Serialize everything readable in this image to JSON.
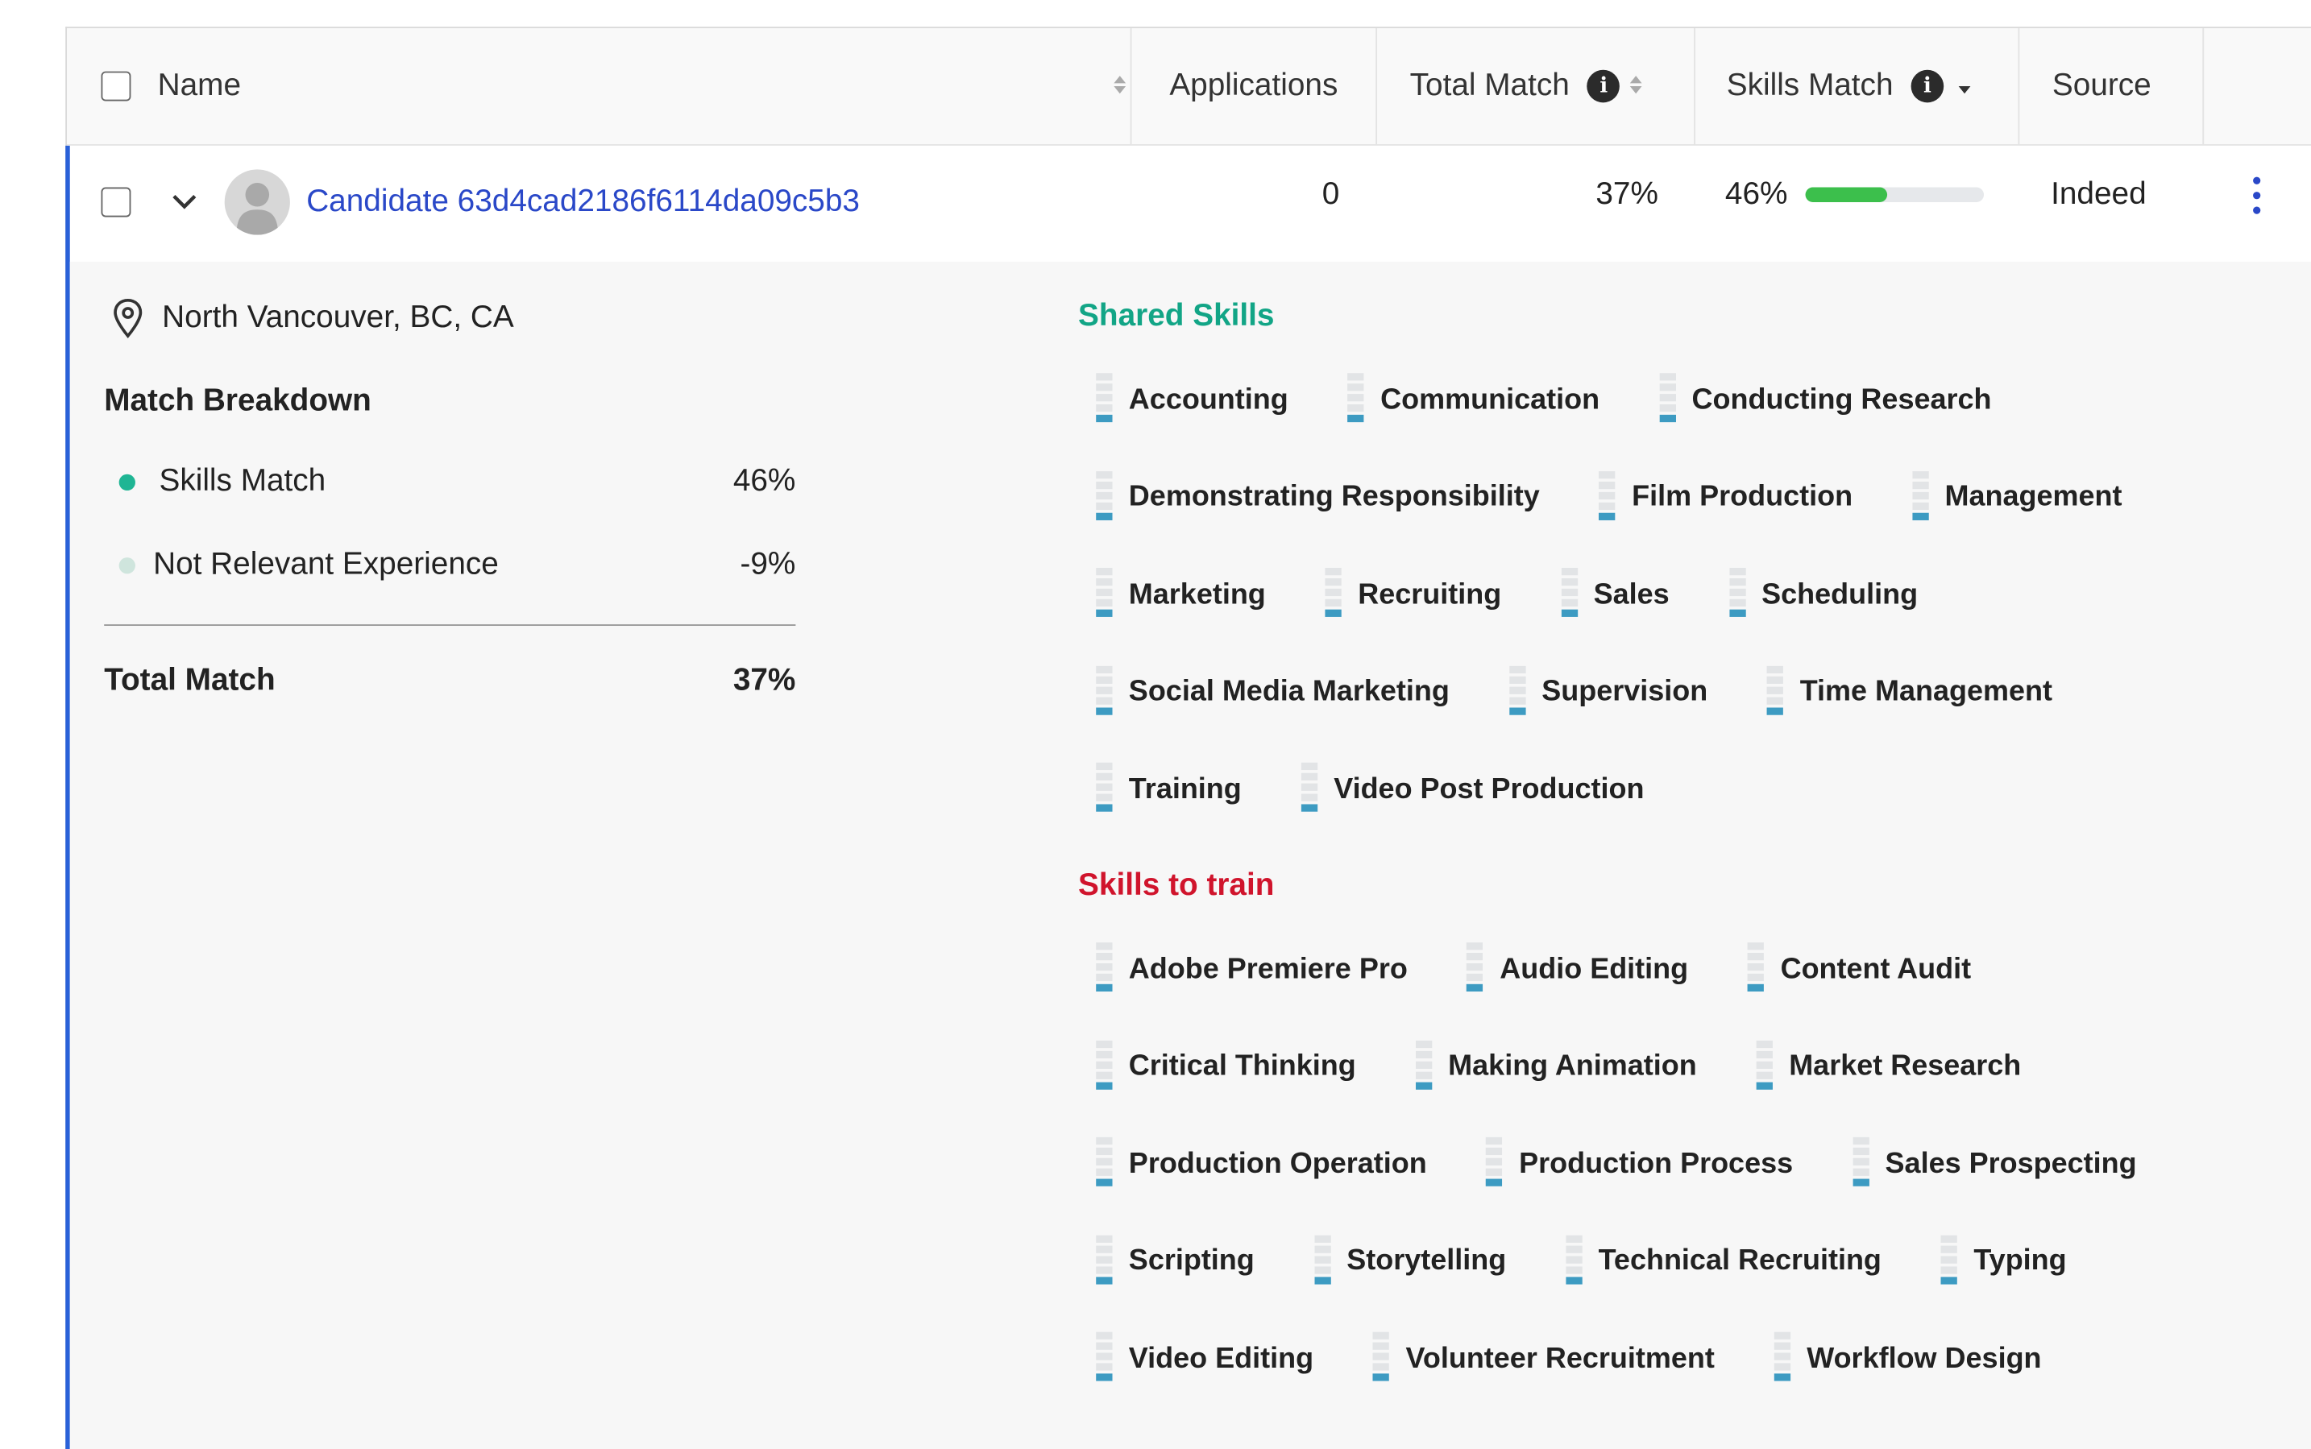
{
  "header": {
    "columns": {
      "name": "Name",
      "applications": "Applications",
      "total_match": "Total Match",
      "skills_match": "Skills Match",
      "source": "Source"
    }
  },
  "candidate": {
    "name": "Candidate 63d4cad2186f6114da09c5b3",
    "applications": "0",
    "total_match": "37%",
    "skills_match": "46%",
    "skills_match_fraction": 0.46,
    "source": "Indeed",
    "location": "North Vancouver, BC, CA"
  },
  "match_breakdown": {
    "title": "Match Breakdown",
    "items": [
      {
        "label": "Skills Match",
        "value": "46%",
        "color": "#1fb594"
      },
      {
        "label": "Not Relevant Experience",
        "value": "-9%",
        "color": "#cfe5dd"
      }
    ],
    "total_label": "Total Match",
    "total_value": "37%"
  },
  "shared_skills": {
    "title": "Shared Skills",
    "color": "#12a586",
    "items": [
      "Accounting",
      "Communication",
      "Conducting Research",
      "Demonstrating Responsibility",
      "Film Production",
      "Management",
      "Marketing",
      "Recruiting",
      "Sales",
      "Scheduling",
      "Social Media Marketing",
      "Supervision",
      "Time Management",
      "Training",
      "Video Post Production"
    ]
  },
  "skills_to_train": {
    "title": "Skills to train",
    "color": "#d0142c",
    "items": [
      "Adobe Premiere Pro",
      "Audio Editing",
      "Content Audit",
      "Critical Thinking",
      "Making Animation",
      "Market Research",
      "Production Operation",
      "Production Process",
      "Sales Prospecting",
      "Scripting",
      "Storytelling",
      "Technical Recruiting",
      "Typing",
      "Video Editing",
      "Volunteer Recruitment",
      "Workflow Design"
    ]
  },
  "colors": {
    "link": "#2a48c8",
    "accent_bar": "#2a61d8",
    "progress": "#3cbf4c",
    "skill_level": "#3d9bc2"
  },
  "icons": [
    "checkbox-icon",
    "sort-icon",
    "info-icon",
    "caret-down-icon",
    "chevron-down-icon",
    "avatar-icon",
    "location-pin-icon",
    "kebab-menu-icon",
    "skill-level-icon"
  ]
}
